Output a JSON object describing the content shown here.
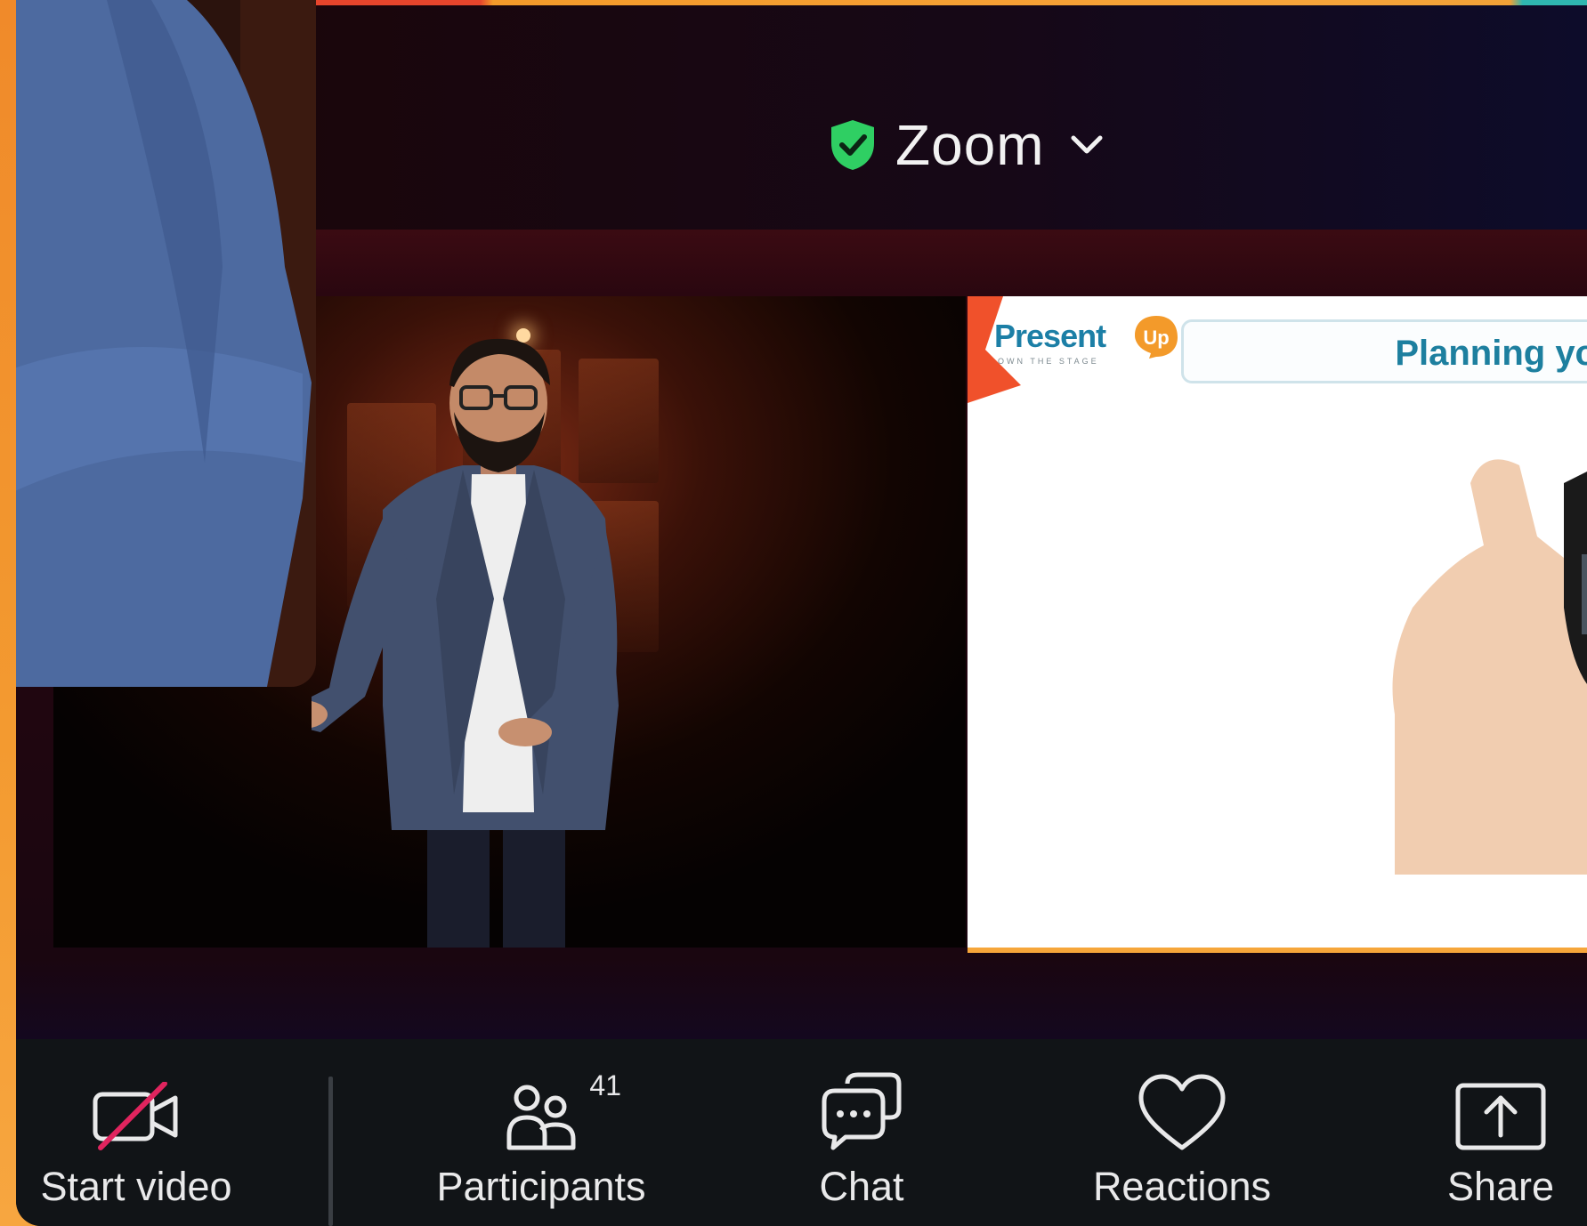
{
  "header": {
    "meeting_name": "Zoom"
  },
  "slide": {
    "brand": "Present",
    "brand_up": "Up",
    "brand_tagline": "OWN THE STAGE",
    "title": "Planning yo"
  },
  "toolbar": {
    "start_video": "Start video",
    "participants": "Participants",
    "participants_count": "41",
    "chat": "Chat",
    "reactions": "Reactions",
    "share": "Share"
  },
  "colors": {
    "shield": "#2fcf63",
    "brand": "#1c7fa6",
    "accent_orange": "#f39a2a",
    "toolbar_bg": "#111417",
    "muted_slash": "#e0245e"
  }
}
